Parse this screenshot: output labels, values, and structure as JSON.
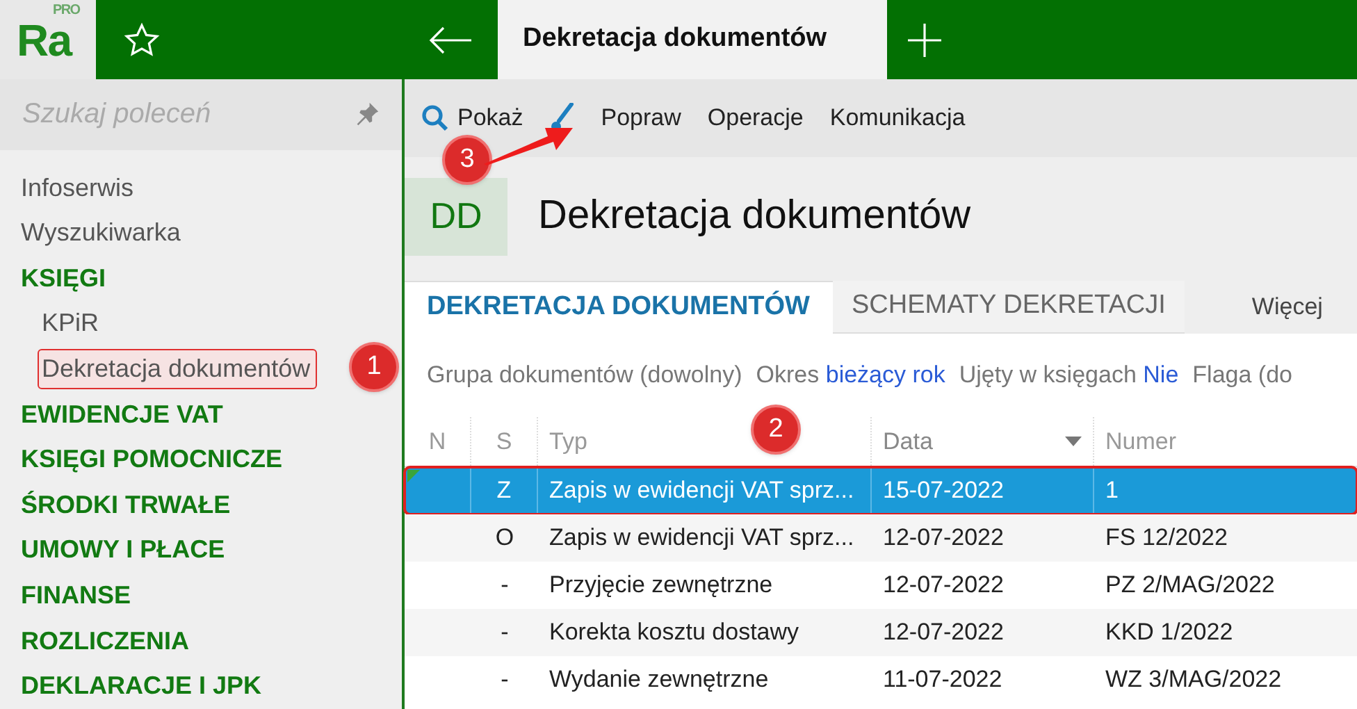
{
  "logo": {
    "text": "Ra",
    "badge": "PRO"
  },
  "tabs": [
    {
      "label": "Dekretacja dokumentów",
      "selected": true
    }
  ],
  "sidebar": {
    "search": {
      "placeholder": "Szukaj poleceń"
    },
    "items": [
      {
        "label": "Infoserwis",
        "kind": "link",
        "selected": false
      },
      {
        "label": "Wyszukiwarka",
        "kind": "link",
        "selected": false
      },
      {
        "label": "KSIĘGI",
        "kind": "section",
        "selected": false,
        "children": [
          {
            "label": "KPiR",
            "kind": "link",
            "selected": false
          },
          {
            "label": "Dekretacja dokumentów",
            "kind": "link",
            "selected": true
          }
        ]
      },
      {
        "label": "EWIDENCJE VAT",
        "kind": "section",
        "selected": false
      },
      {
        "label": "KSIĘGI POMOCNICZE",
        "kind": "section",
        "selected": false
      },
      {
        "label": "ŚRODKI TRWAŁE",
        "kind": "section",
        "selected": false
      },
      {
        "label": "UMOWY I PŁACE",
        "kind": "section",
        "selected": false
      },
      {
        "label": "FINANSE",
        "kind": "section",
        "selected": false
      },
      {
        "label": "ROZLICZENIA",
        "kind": "section",
        "selected": false
      },
      {
        "label": "DEKLARACJE I JPK",
        "kind": "section",
        "selected": false
      }
    ]
  },
  "toolbar": [
    {
      "label": "Pokaż",
      "kind": "search"
    },
    {
      "kind": "brush"
    },
    {
      "label": "Popraw",
      "kind": "text"
    },
    {
      "label": "Operacje",
      "kind": "text"
    },
    {
      "label": "Komunikacja",
      "kind": "text"
    }
  ],
  "page": {
    "badge": "DD",
    "title": "Dekretacja dokumentów"
  },
  "view_tabs": [
    {
      "label": "DEKRETACJA DOKUMENTÓW",
      "selected": true
    },
    {
      "label": "SCHEMATY DEKRETACJI",
      "selected": false
    }
  ],
  "more": "Więcej",
  "filters": [
    {
      "label": "Grupa dokumentów (dowolny)"
    },
    {
      "label": "Okres",
      "value": "bieżący rok"
    },
    {
      "label": "Ujęty w księgach",
      "value": "Nie"
    },
    {
      "label": "Flaga (do"
    }
  ],
  "table": {
    "columns": [
      {
        "label": "N",
        "sorted": false
      },
      {
        "label": "S",
        "sorted": false
      },
      {
        "label": "Typ",
        "sorted": false
      },
      {
        "label": "Data",
        "sorted": true
      },
      {
        "label": "Numer",
        "sorted": false
      }
    ],
    "rows": [
      {
        "selected": true,
        "flagged": true,
        "cells": [
          "",
          "Z",
          "Zapis w ewidencji VAT sprz...",
          "15-07-2022",
          "1"
        ]
      },
      {
        "selected": false,
        "flagged": false,
        "cells": [
          "",
          "O",
          "Zapis w ewidencji VAT sprz...",
          "12-07-2022",
          "FS 12/2022"
        ]
      },
      {
        "selected": false,
        "flagged": false,
        "cells": [
          "",
          "-",
          "Przyjęcie zewnętrzne",
          "12-07-2022",
          "PZ 2/MAG/2022"
        ]
      },
      {
        "selected": false,
        "flagged": false,
        "cells": [
          "",
          "-",
          "Korekta kosztu dostawy",
          "12-07-2022",
          "KKD 1/2022"
        ]
      },
      {
        "selected": false,
        "flagged": false,
        "cells": [
          "",
          "-",
          "Wydanie zewnętrzne",
          "11-07-2022",
          "WZ 3/MAG/2022"
        ]
      }
    ]
  },
  "callouts": [
    {
      "number": "1"
    },
    {
      "number": "2"
    },
    {
      "number": "3"
    }
  ]
}
